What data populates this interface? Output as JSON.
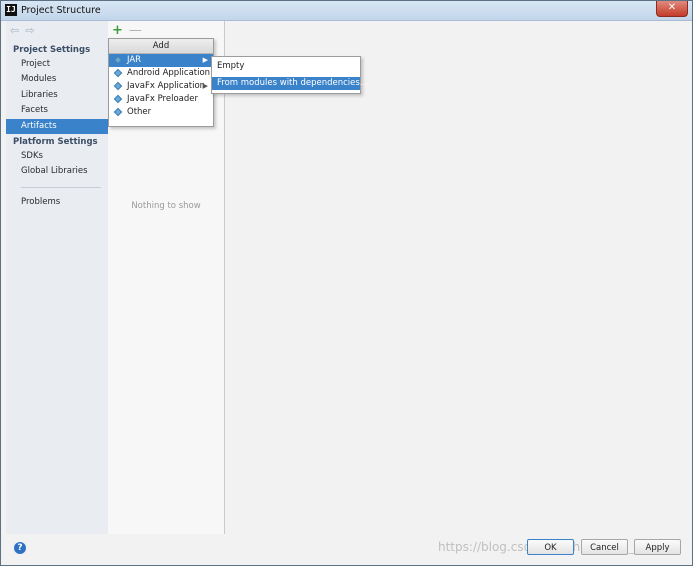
{
  "window": {
    "title": "Project Structure",
    "icon": "intellij-icon",
    "close_label": "✕"
  },
  "nav": {
    "back_icon": "back-arrow-icon",
    "forward_icon": "forward-arrow-icon"
  },
  "sidebar": {
    "project_settings_header": "Project Settings",
    "project_items": [
      {
        "label": "Project"
      },
      {
        "label": "Modules"
      },
      {
        "label": "Libraries"
      },
      {
        "label": "Facets"
      },
      {
        "label": "Artifacts",
        "selected": true
      }
    ],
    "platform_settings_header": "Platform Settings",
    "platform_items": [
      {
        "label": "SDKs"
      },
      {
        "label": "Global Libraries"
      }
    ],
    "problems_label": "Problems"
  },
  "middle": {
    "add_symbol": "+",
    "remove_symbol": "—",
    "empty_text": "Nothing to show"
  },
  "add_menu": {
    "header": "Add",
    "items": [
      {
        "label": "JAR",
        "selected": true,
        "has_submenu": true
      },
      {
        "label": "Android Application",
        "has_submenu": false
      },
      {
        "label": "JavaFx Application",
        "has_submenu": true
      },
      {
        "label": "JavaFx Preloader",
        "has_submenu": false
      },
      {
        "label": "Other",
        "has_submenu": false
      }
    ],
    "submenu_arrow": "▶"
  },
  "jar_submenu": {
    "items": [
      {
        "label": "Empty"
      },
      {
        "label": "From modules with dependencies...",
        "selected": true
      }
    ]
  },
  "footer": {
    "help_label": "?",
    "ok_label": "OK",
    "cancel_label": "Cancel",
    "apply_label": "Apply",
    "watermark": "https://blog.csdn.net/zhangbiao_..."
  },
  "colors": {
    "selection": "#3a82c9",
    "add_green": "#3e9b3e"
  }
}
